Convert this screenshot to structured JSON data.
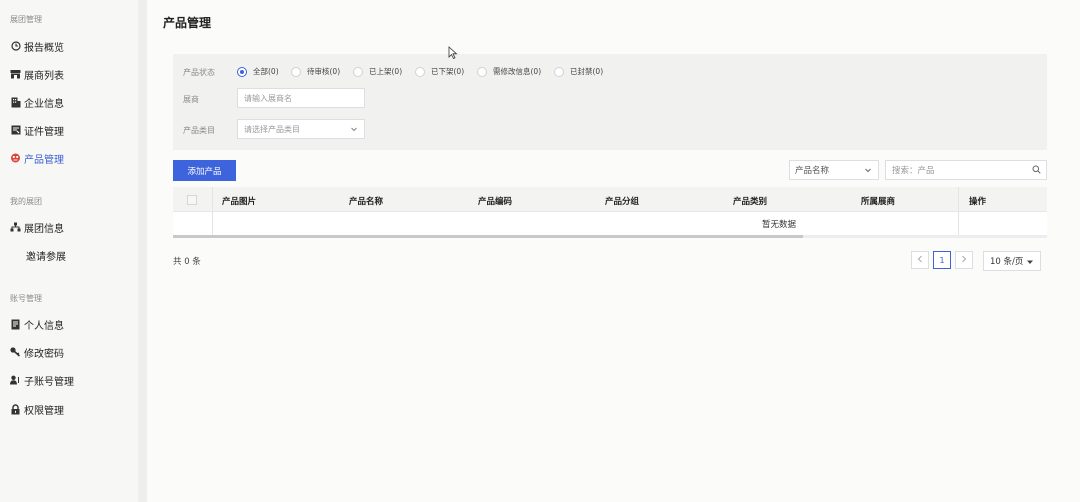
{
  "sidebar": {
    "groups": [
      "展团管理",
      "我的展团",
      "账号管理"
    ],
    "items": [
      {
        "label": "报告概览"
      },
      {
        "label": "展商列表"
      },
      {
        "label": "企业信息"
      },
      {
        "label": "证件管理"
      },
      {
        "label": "产品管理",
        "active": true
      },
      {
        "label": "展团信息"
      },
      {
        "label": "邀请参展"
      },
      {
        "label": "个人信息"
      },
      {
        "label": "修改密码"
      },
      {
        "label": "子账号管理"
      },
      {
        "label": "权限管理"
      }
    ]
  },
  "page": {
    "title": "产品管理"
  },
  "filters": {
    "status_label": "产品状态",
    "status_options": [
      {
        "label": "全部(0)",
        "checked": true
      },
      {
        "label": "待审核(0)"
      },
      {
        "label": "已上架(0)"
      },
      {
        "label": "已下架(0)"
      },
      {
        "label": "需修改信息(0)"
      },
      {
        "label": "已封禁(0)"
      }
    ],
    "exhibitor_label": "展商",
    "exhibitor_placeholder": "请输入展商名",
    "category_label": "产品类目",
    "category_placeholder": "请选择产品类目"
  },
  "toolbar": {
    "add_label": "添加产品",
    "search_field": "产品名称",
    "search_placeholder": "搜索：产品"
  },
  "table": {
    "columns": [
      "产品图片",
      "产品名称",
      "产品编码",
      "产品分组",
      "产品类别",
      "所属展商",
      "操作"
    ],
    "empty_text": "暂无数据"
  },
  "footer": {
    "total": "共 0 条",
    "current_page": "1",
    "page_size": "10 条/页"
  },
  "colors": {
    "accent": "#3d63dd",
    "active_nav": "#3d5fd6",
    "active_icon": "#d9443b"
  }
}
